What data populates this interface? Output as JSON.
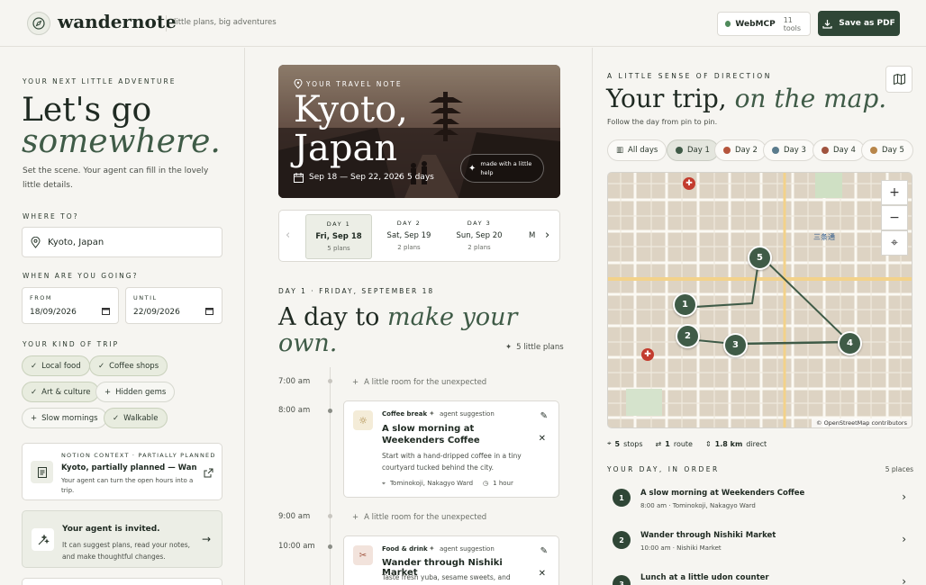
{
  "app": {
    "name": "wandernote",
    "tagline": "little plans, big adventures"
  },
  "header": {
    "webmcp_label": "WebMCP",
    "webmcp_tools": "11 tools",
    "save_pdf": "Save as PDF"
  },
  "left": {
    "kicker": "YOUR NEXT LITTLE ADVENTURE",
    "title_line1": "Let's go",
    "title_line2": "somewhere.",
    "subtitle": "Set the scene. Your agent can fill in the lovely little details.",
    "where_label": "WHERE TO?",
    "where_value": "Kyoto, Japan",
    "when_label": "WHEN ARE YOU GOING?",
    "from_label": "FROM",
    "from_value": "18/09/2026",
    "until_label": "UNTIL",
    "until_value": "22/09/2026",
    "kind_label": "YOUR KIND OF TRIP",
    "chips": [
      {
        "label": "Local food",
        "on": true
      },
      {
        "label": "Coffee shops",
        "on": true
      },
      {
        "label": "Art & culture",
        "on": true
      },
      {
        "label": "Hidden gems",
        "on": false
      },
      {
        "label": "Slow mornings",
        "on": false
      },
      {
        "label": "Walkable",
        "on": true
      }
    ],
    "notion": {
      "kicker": "NOTION CONTEXT · PARTIALLY PLANNED",
      "title": "Kyoto, partially planned — WanderN...",
      "desc": "Your agent can turn the open hours into a trip."
    },
    "invite": {
      "title": "Your agent is invited.",
      "desc": "It can suggest plans, read your notes, and make thoughtful changes."
    }
  },
  "hero": {
    "kicker": "YOUR TRAVEL NOTE",
    "city": "Kyoto,",
    "country": "Japan",
    "dates": "Sep 18 — Sep 22, 2026",
    "sep": "·",
    "days": "5 days",
    "help": "made with a little help"
  },
  "day_tabs": [
    {
      "day": "DAY 1",
      "date": "Fri, Sep 18",
      "plans": "5 plans"
    },
    {
      "day": "DAY 2",
      "date": "Sat, Sep 19",
      "plans": "2 plans"
    },
    {
      "day": "DAY 3",
      "date": "Sun, Sep 20",
      "plans": "2 plans"
    },
    {
      "day": "",
      "date": "M",
      "plans": ""
    }
  ],
  "day_view": {
    "kicker": "DAY 1 · FRIDAY, SEPTEMBER 18",
    "title_a": "A day to",
    "title_b": "make your",
    "title_c": "own.",
    "plans_count": "5 little plans",
    "room_text": "A little room for the unexpected",
    "times": [
      "7:00 am",
      "8:00 am",
      "9:00 am",
      "10:00 am"
    ],
    "events": [
      {
        "category": "Coffee break",
        "tag": "agent suggestion",
        "title": "A slow morning at Weekenders Coffee",
        "desc": "Start with a hand-dripped coffee in a tiny courtyard tucked behind the city.",
        "place": "Tominokoji, Nakagyo Ward",
        "duration": "1 hour"
      },
      {
        "category": "Food & drink",
        "tag": "agent suggestion",
        "title": "Wander through Nishiki Market",
        "desc": "Taste fresh yuba, sesame sweets, and"
      }
    ]
  },
  "right": {
    "kicker": "A LITTLE SENSE OF DIRECTION",
    "title_a": "Your trip,",
    "title_b": "on the map.",
    "subtitle": "Follow the day from pin to pin.",
    "day_chips": [
      {
        "label": "All days",
        "color": ""
      },
      {
        "label": "Day 1",
        "color": "#3f5b47"
      },
      {
        "label": "Day 2",
        "color": "#b5553c"
      },
      {
        "label": "Day 3",
        "color": "#5a7b8c"
      },
      {
        "label": "Day 4",
        "color": "#a0533e"
      },
      {
        "label": "Day 5",
        "color": "#b8864a"
      }
    ],
    "map_attribution": "© OpenStreetMap contributors",
    "map_label": "三条通",
    "pins": [
      "1",
      "2",
      "3",
      "4",
      "5"
    ],
    "stats": {
      "stops_num": "5",
      "stops": "stops",
      "route_num": "1",
      "route": "route",
      "km": "1.8 km",
      "direct": "direct"
    },
    "order_label": "YOUR DAY, IN ORDER",
    "places": "5 places",
    "order": [
      {
        "num": "1",
        "title": "A slow morning at Weekenders Coffee",
        "meta": "8:00 am · Tominokoji, Nakagyo Ward"
      },
      {
        "num": "2",
        "title": "Wander through Nishiki Market",
        "meta": "10:00 am · Nishiki Market"
      },
      {
        "num": "3",
        "title": "Lunch at a little udon counter",
        "meta": ""
      }
    ]
  }
}
